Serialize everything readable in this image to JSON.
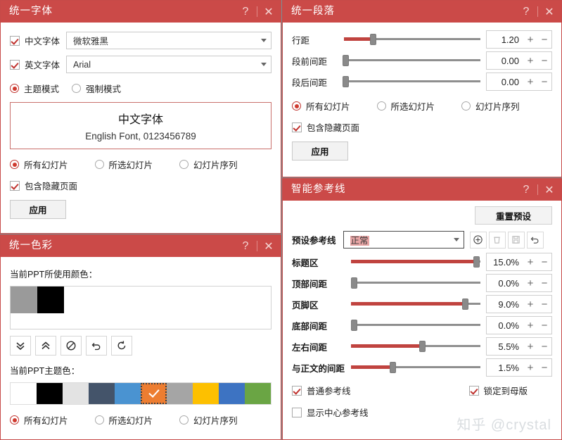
{
  "theme": {
    "header_red": "#cb4a48",
    "accent_red": "#c0433f",
    "desktop_bg": "#7e9094"
  },
  "font_panel": {
    "title": "统一字体",
    "help_label": "?",
    "close_label": "✕",
    "cn_font": {
      "checkbox_label": "中文字体",
      "value": "微软雅黑",
      "checked": true
    },
    "en_font": {
      "checkbox_label": "英文字体",
      "value": "Arial",
      "checked": true
    },
    "modes": [
      {
        "label": "主题模式",
        "selected": true
      },
      {
        "label": "强制模式",
        "selected": false
      }
    ],
    "preview": {
      "cn_text": "中文字体",
      "en_text": "English Font, 0123456789"
    },
    "scope": [
      {
        "label": "所有幻灯片",
        "selected": true
      },
      {
        "label": "所选幻灯片",
        "selected": false
      },
      {
        "label": "幻灯片序列",
        "selected": false
      }
    ],
    "include_hidden": {
      "label": "包含隐藏页面",
      "checked": true
    },
    "apply_label": "应用"
  },
  "color_panel": {
    "title": "统一色彩",
    "help_label": "?",
    "close_label": "✕",
    "used_colors_label": "当前PPT所使用颜色：",
    "used_colors": [
      "#9a9a9a",
      "#000000"
    ],
    "tools": [
      {
        "name": "expand-down-icon",
        "glyph": "chevrons-down"
      },
      {
        "name": "collapse-up-icon",
        "glyph": "chevrons-up"
      },
      {
        "name": "ban-icon",
        "glyph": "ban"
      },
      {
        "name": "undo-icon",
        "glyph": "undo"
      },
      {
        "name": "redo-icon",
        "glyph": "redo"
      }
    ],
    "theme_colors_label": "当前PPT主题色：",
    "theme_colors": [
      {
        "hex": "#ffffff",
        "selected": false
      },
      {
        "hex": "#000000",
        "selected": false
      },
      {
        "hex": "#e3e3e3",
        "selected": false
      },
      {
        "hex": "#44546a",
        "selected": false
      },
      {
        "hex": "#4a93d1",
        "selected": false
      },
      {
        "hex": "#ed7d31",
        "selected": true
      },
      {
        "hex": "#a5a5a5",
        "selected": false
      },
      {
        "hex": "#fdc000",
        "selected": false
      },
      {
        "hex": "#3d73c2",
        "selected": false
      },
      {
        "hex": "#6aa544",
        "selected": false
      }
    ],
    "scope": [
      {
        "label": "所有幻灯片",
        "selected": true
      },
      {
        "label": "所选幻灯片",
        "selected": false
      },
      {
        "label": "幻灯片序列",
        "selected": false
      }
    ]
  },
  "paragraph_panel": {
    "title": "统一段落",
    "help_label": "?",
    "close_label": "✕",
    "sliders": [
      {
        "label": "行距",
        "value": "1.20",
        "percent": 21
      },
      {
        "label": "段前间距",
        "value": "0.00",
        "percent": 1
      },
      {
        "label": "段后间距",
        "value": "0.00",
        "percent": 1
      }
    ],
    "spin_plus": "+",
    "spin_minus": "−",
    "scope": [
      {
        "label": "所有幻灯片",
        "selected": true
      },
      {
        "label": "所选幻灯片",
        "selected": false
      },
      {
        "label": "幻灯片序列",
        "selected": false
      }
    ],
    "include_hidden": {
      "label": "包含隐藏页面",
      "checked": true
    },
    "apply_label": "应用"
  },
  "guides_panel": {
    "title": "智能参考线",
    "help_label": "?",
    "close_label": "✕",
    "reset_label": "重置预设",
    "preset_label": "预设参考线",
    "preset_value": "正常",
    "actions": [
      {
        "name": "add-preset-icon",
        "glyph": "plus-circle",
        "disabled": false
      },
      {
        "name": "delete-preset-icon",
        "glyph": "trash",
        "disabled": true
      },
      {
        "name": "save-preset-icon",
        "glyph": "save",
        "disabled": true
      },
      {
        "name": "undo-preset-icon",
        "glyph": "undo",
        "disabled": false
      }
    ],
    "sliders": [
      {
        "label": "标题区",
        "value": "15.0%",
        "percent": 97
      },
      {
        "label": "顶部间距",
        "value": "0.0%",
        "percent": 2
      },
      {
        "label": "页脚区",
        "value": "9.0%",
        "percent": 88
      },
      {
        "label": "底部间距",
        "value": "0.0%",
        "percent": 2
      },
      {
        "label": "左右间距",
        "value": "5.5%",
        "percent": 55
      },
      {
        "label": "与正文的间距",
        "value": "1.5%",
        "percent": 32
      }
    ],
    "spin_plus": "+",
    "spin_minus": "−",
    "checks": [
      {
        "label": "普通参考线",
        "checked": true
      },
      {
        "label": "锁定到母版",
        "checked": true
      },
      {
        "label": "显示中心参考线",
        "checked": false
      }
    ]
  },
  "watermark": "知乎 @crystal"
}
